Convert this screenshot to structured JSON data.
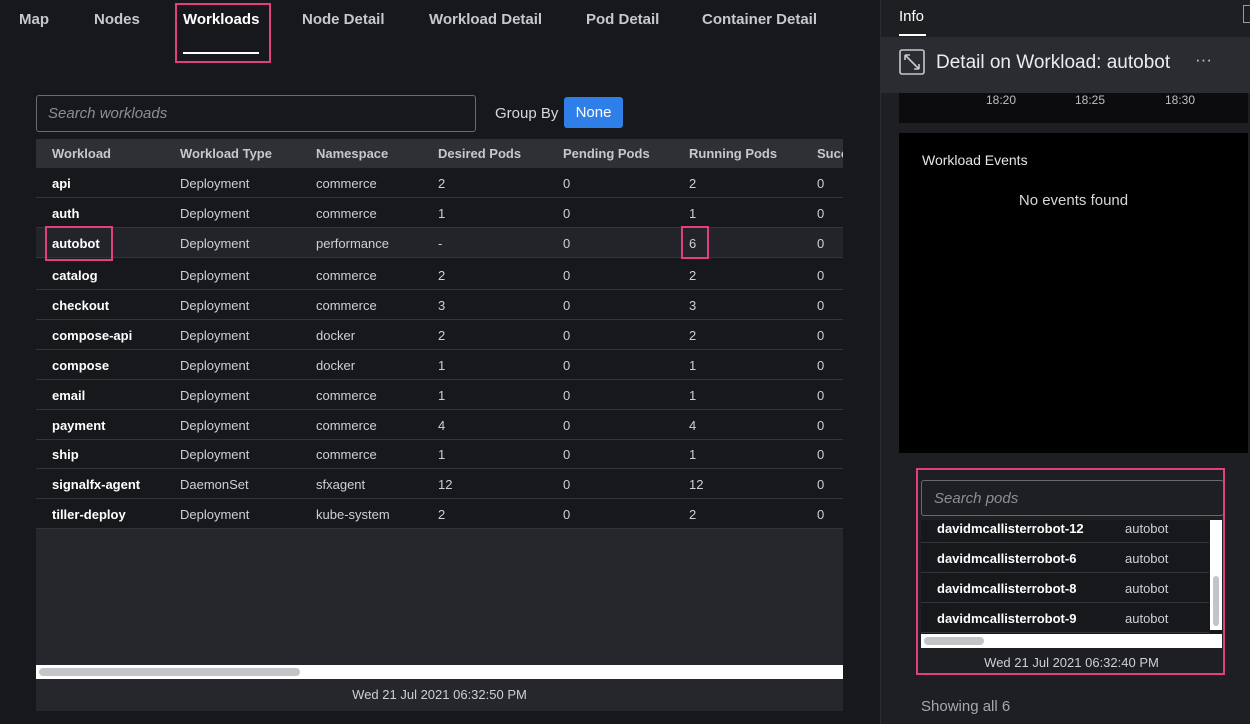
{
  "tabs": [
    {
      "label": "Map"
    },
    {
      "label": "Nodes"
    },
    {
      "label": "Workloads"
    },
    {
      "label": "Node Detail"
    },
    {
      "label": "Workload Detail"
    },
    {
      "label": "Pod Detail"
    },
    {
      "label": "Container Detail"
    }
  ],
  "active_tab": "Workloads",
  "search": {
    "placeholder": "Search workloads"
  },
  "group_by": {
    "label": "Group By",
    "value": "None"
  },
  "table": {
    "columns": [
      "Workload",
      "Workload Type",
      "Namespace",
      "Desired Pods",
      "Pending Pods",
      "Running Pods",
      "Succ"
    ],
    "rows": [
      [
        "api",
        "Deployment",
        "commerce",
        "2",
        "0",
        "2",
        "0"
      ],
      [
        "auth",
        "Deployment",
        "commerce",
        "1",
        "0",
        "1",
        "0"
      ],
      [
        "autobot",
        "Deployment",
        "performance",
        "-",
        "0",
        "6",
        "0"
      ],
      [
        "catalog",
        "Deployment",
        "commerce",
        "2",
        "0",
        "2",
        "0"
      ],
      [
        "checkout",
        "Deployment",
        "commerce",
        "3",
        "0",
        "3",
        "0"
      ],
      [
        "compose-api",
        "Deployment",
        "docker",
        "2",
        "0",
        "2",
        "0"
      ],
      [
        "compose",
        "Deployment",
        "docker",
        "1",
        "0",
        "1",
        "0"
      ],
      [
        "email",
        "Deployment",
        "commerce",
        "1",
        "0",
        "1",
        "0"
      ],
      [
        "payment",
        "Deployment",
        "commerce",
        "4",
        "0",
        "4",
        "0"
      ],
      [
        "ship",
        "Deployment",
        "commerce",
        "1",
        "0",
        "1",
        "0"
      ],
      [
        "signalfx-agent",
        "DaemonSet",
        "sfxagent",
        "12",
        "0",
        "12",
        "0"
      ],
      [
        "tiller-deploy",
        "Deployment",
        "kube-system",
        "2",
        "0",
        "2",
        "0"
      ]
    ],
    "selected_row": "autobot",
    "footer_time": "Wed 21 Jul 2021 06:32:50 PM"
  },
  "panel": {
    "tab_label": "Info",
    "title": "Detail on Workload: autobot",
    "more_label": "···",
    "chart_ticks": [
      "18:20",
      "18:25",
      "18:30"
    ],
    "events": {
      "title": "Workload Events",
      "empty": "No events found"
    },
    "pods": {
      "placeholder": "Search pods",
      "rows": [
        {
          "name": "davidmcallisterrobot-12",
          "workload": "autobot"
        },
        {
          "name": "davidmcallisterrobot-6",
          "workload": "autobot"
        },
        {
          "name": "davidmcallisterrobot-8",
          "workload": "autobot"
        },
        {
          "name": "davidmcallisterrobot-9",
          "workload": "autobot"
        }
      ],
      "time": "Wed 21 Jul 2021 06:32:40 PM"
    },
    "showing": "Showing all 6"
  },
  "colors": {
    "accent": "#2f7fe8",
    "highlight": "#e0407e",
    "background": "#17181c"
  },
  "icons": {
    "expand": "expand-icon",
    "close": "close-icon",
    "more": "more-icon"
  }
}
